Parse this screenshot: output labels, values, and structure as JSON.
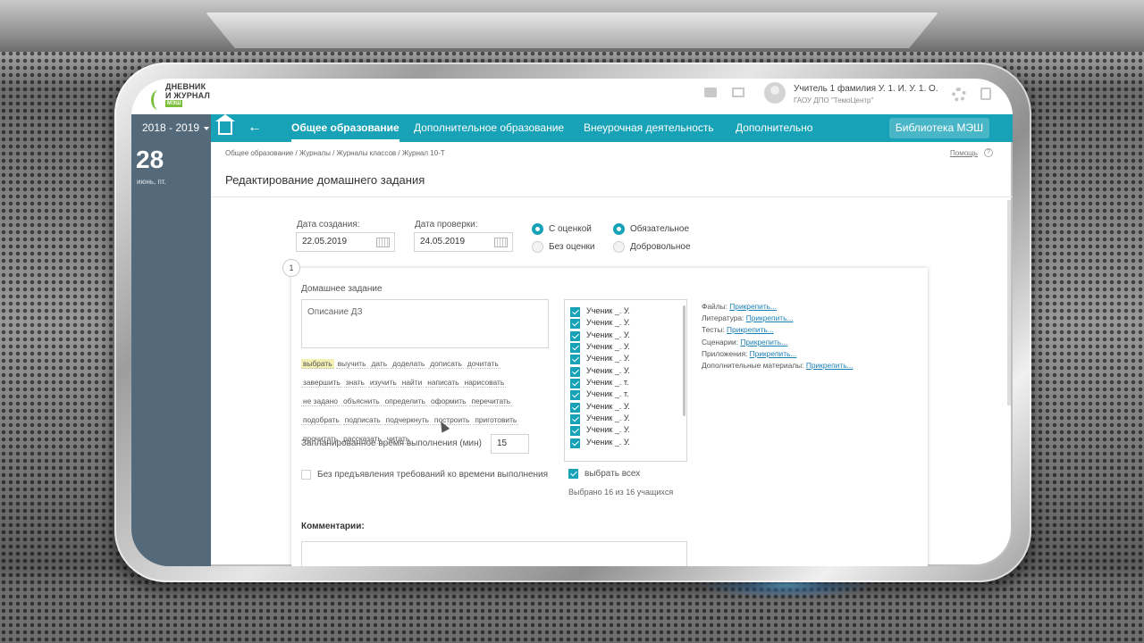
{
  "logo": {
    "line1": "ДНЕВНИК",
    "line2": "И ЖУРНАЛ",
    "badge": "МЭШ"
  },
  "header": {
    "user_name": "Учитель 1 фамилия У. 1. И. У. 1. О.",
    "user_org": "ГАОУ ДПО \"ТемоЦентр\""
  },
  "nav": {
    "year": "2018 - 2019",
    "back": "←",
    "items": [
      "Общее образование",
      "Дополнительное образование",
      "Внеурочная деятельность",
      "Дополнительно"
    ],
    "library": "Библиотека МЭШ"
  },
  "sidebar": {
    "day": "28",
    "weekday": "июнь, пт."
  },
  "breadcrumb": "Общее образование / Журналы / Журналы классов / Журнал 10-Т",
  "help": "Помощь",
  "help_q": "?",
  "page_title": "Редактирование домашнего задания",
  "form": {
    "created_label": "Дата создания:",
    "created_value": "22.05.2019",
    "check_label": "Дата проверки:",
    "check_value": "24.05.2019",
    "grade_options": [
      "С оценкой",
      "Без оценки"
    ],
    "grade_selected": "С оценкой",
    "mandatory_options": [
      "Обязательное",
      "Добровольное"
    ],
    "mandatory_selected": "Обязательное"
  },
  "homework": {
    "step": "1",
    "title": "Домашнее задание",
    "description_placeholder": "Описание ДЗ",
    "tags": [
      "выбрать",
      "выучить",
      "дать",
      "доделать",
      "дописать",
      "дочитать",
      "завершить",
      "знать",
      "изучить",
      "найти",
      "написать",
      "нарисовать",
      "не задано",
      "объяснить",
      "определить",
      "оформить",
      "перечитать",
      "подобрать",
      "подписать",
      "подчеркнуть",
      "построить",
      "приготовить",
      "прочитать",
      "рассказать",
      "читать"
    ],
    "planned_label": "Запланированное время выполнения (мин)",
    "planned_value": "15",
    "no_time_label": "Без предъявления требований ко времени выполнения",
    "students": [
      "Ученик _. У.",
      "Ученик _. У.",
      "Ученик _. У.",
      "Ученик _. У.",
      "Ученик _. У.",
      "Ученик _. У.",
      "Ученик _. т.",
      "Ученик _. т.",
      "Ученик _. У.",
      "Ученик _. У.",
      "Ученик _. У.",
      "Ученик _. У."
    ],
    "select_all": "выбрать всех",
    "selected_count": "Выбрано 16 из 16 учащихся",
    "attachments": [
      {
        "label": "Файлы:",
        "link": "Прикрепить..."
      },
      {
        "label": "Литература:",
        "link": "Прикрепить..."
      },
      {
        "label": "Тесты:",
        "link": "Прикрепить..."
      },
      {
        "label": "Сценарии:",
        "link": "Прикрепить..."
      },
      {
        "label": "Приложения:",
        "link": "Прикрепить..."
      },
      {
        "label": "Дополнительные материалы:",
        "link": "Прикрепить..."
      }
    ],
    "comments_label": "Комментарии:"
  },
  "colors": {
    "accent": "#17a2b8",
    "sidebar": "#546a7b",
    "link": "#1a7fb5"
  }
}
